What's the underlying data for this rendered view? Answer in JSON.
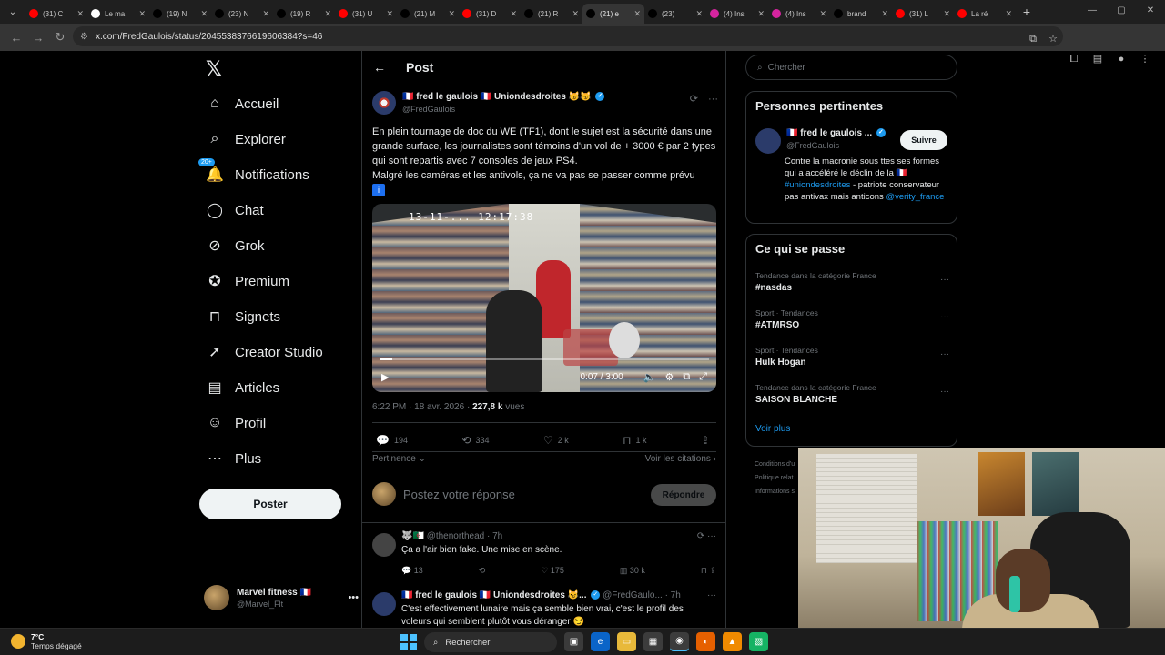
{
  "browser": {
    "tabs": [
      {
        "label": "(31) C",
        "icon": "youtube-icon",
        "color": "#ff0000"
      },
      {
        "label": "Le ma",
        "icon": "google-icon",
        "color": "#ffffff"
      },
      {
        "label": "(19) N",
        "icon": "x-icon",
        "color": "#000000"
      },
      {
        "label": "(23) N",
        "icon": "x-icon",
        "color": "#000000"
      },
      {
        "label": "(19) R",
        "icon": "x-icon",
        "color": "#000000"
      },
      {
        "label": "(31) U",
        "icon": "youtube-icon",
        "color": "#ff0000"
      },
      {
        "label": "(21) M",
        "icon": "x-icon",
        "color": "#000000"
      },
      {
        "label": "(31) D",
        "icon": "youtube-icon",
        "color": "#ff0000"
      },
      {
        "label": "(21) R",
        "icon": "x-icon",
        "color": "#000000"
      },
      {
        "label": "(21) e",
        "icon": "x-icon",
        "color": "#000000",
        "active": true
      },
      {
        "label": "(23)",
        "icon": "x-icon",
        "color": "#000000"
      },
      {
        "label": "(4) Ins",
        "icon": "instagram-icon",
        "color": "#d6249f"
      },
      {
        "label": "(4) Ins",
        "icon": "instagram-icon",
        "color": "#d6249f"
      },
      {
        "label": "brand",
        "icon": "tiktok-icon",
        "color": "#000000"
      },
      {
        "label": "(31) L",
        "icon": "youtube-icon",
        "color": "#ff0000"
      },
      {
        "label": "La ré",
        "icon": "youtube-icon",
        "color": "#ff0000"
      }
    ],
    "url": "x.com/FredGaulois/status/2045538376619606384?s=46"
  },
  "nav": {
    "items": [
      {
        "label": "Accueil",
        "icon": "home-icon"
      },
      {
        "label": "Explorer",
        "icon": "search-icon"
      },
      {
        "label": "Notifications",
        "icon": "bell-icon",
        "badge": "20+"
      },
      {
        "label": "Chat",
        "icon": "chat-icon"
      },
      {
        "label": "Grok",
        "icon": "grok-icon"
      },
      {
        "label": "Premium",
        "icon": "premium-icon"
      },
      {
        "label": "Signets",
        "icon": "bookmark-icon"
      },
      {
        "label": "Creator Studio",
        "icon": "rocket-icon"
      },
      {
        "label": "Articles",
        "icon": "articles-icon"
      },
      {
        "label": "Profil",
        "icon": "profile-icon"
      },
      {
        "label": "Plus",
        "icon": "more-circle-icon"
      }
    ],
    "post_button": "Poster",
    "account": {
      "name": "Marvel fitness 🇫🇷",
      "handle": "@Marvel_Flt"
    }
  },
  "main": {
    "title": "Post",
    "tweet": {
      "author": "🇫🇷 fred le gaulois 🇫🇷 Uniondesdroites 😼😼",
      "handle": "@FredGaulois",
      "text_line1": "En plein tournage de doc du WE (TF1), dont le sujet est la sécurité dans une grande surface, les journalistes sont témoins d'un vol de + 3000 € par 2 types qui sont repartis avec 7 consoles de jeux PS4.",
      "text_line2": "Malgré les caméras et les antivols, ça ne va pas se passer comme prévu",
      "info_emoji": "ℹ️",
      "video": {
        "stamp": "13-11-... 12:17:38",
        "time": "0:07 / 3:00",
        "progress": 0.039
      },
      "timestamp": "6:22 PM · 18 avr. 2026 · ",
      "views": "227,8 k",
      "views_label": " vues",
      "stats": {
        "replies": "194",
        "retweets": "334",
        "likes": "2 k",
        "bookmarks": "1 k"
      }
    },
    "sort_label": "Pertinence",
    "quotes_label": "Voir les citations ›",
    "reply_placeholder": "Postez votre réponse",
    "reply_button": "Répondre",
    "replies": [
      {
        "author": "🐺🇩🇿",
        "handle": "@thenorthead · 7h",
        "text": "Ça a l'air bien fake. Une mise en scène.",
        "stats": {
          "replies": "13",
          "likes": "175",
          "views": "30 k"
        }
      },
      {
        "author": "🇫🇷 fred le gaulois 🇫🇷 Uniondesdroites 😼...",
        "handle": "@FredGaulo... · 7h",
        "text": "C'est effectivement lunaire mais ça semble bien vrai, c'est le profil des voleurs qui semblent plutôt vous déranger 😏"
      }
    ]
  },
  "sidebar": {
    "search_placeholder": "Chercher",
    "relevant": {
      "title": "Personnes pertinentes",
      "name": "🇫🇷 fred le gaulois ...",
      "handle": "@FredGaulois",
      "follow": "Suivre",
      "bio_start": "Contre la macronie sous ttes ses formes qui a accéléré le déclin de la 🇫🇷 ",
      "bio_link1": "#uniondesdroites",
      "bio_mid": " - patriote conservateur pas antivax mais anticons ",
      "bio_link2": "@verity_france"
    },
    "trends": {
      "title": "Ce qui se passe",
      "items": [
        {
          "category": "Tendance dans la catégorie France",
          "name": "#nasdas"
        },
        {
          "category": "Sport · Tendances",
          "name": "#ATMRSO"
        },
        {
          "category": "Sport · Tendances",
          "name": "Hulk Hogan"
        },
        {
          "category": "Tendance dans la catégorie France",
          "name": "SAISON BLANCHE"
        }
      ],
      "see_more": "Voir plus"
    },
    "footer": [
      "Conditions d'u",
      "Politique relat",
      "Informations s"
    ]
  },
  "taskbar": {
    "temp": "7°C",
    "weather": "Temps dégagé",
    "search": "Rechercher"
  }
}
